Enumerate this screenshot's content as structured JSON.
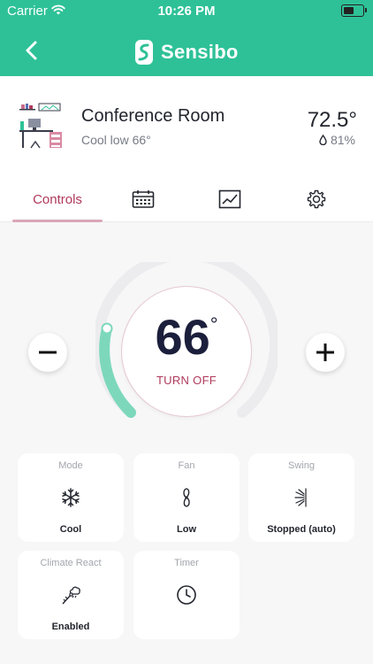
{
  "status_bar": {
    "carrier": "Carrier",
    "time": "10:26 PM"
  },
  "header": {
    "brand": "Sensibo",
    "accent_color": "#2ec197"
  },
  "room": {
    "name": "Conference Room",
    "status": "Cool low 66°",
    "temperature": "72.5°",
    "humidity": "81%"
  },
  "tabs": [
    {
      "label": "Controls",
      "icon": "",
      "active": true
    },
    {
      "label": "",
      "icon": "calendar-icon"
    },
    {
      "label": "",
      "icon": "chart-icon"
    },
    {
      "label": "",
      "icon": "gear-icon"
    }
  ],
  "thermostat": {
    "setpoint": "66",
    "unit": "°",
    "turn_off_label": "TURN OFF",
    "accent_color": "#b03a5b"
  },
  "cards": [
    {
      "label": "Mode",
      "value": "Cool",
      "icon": "snowflake-icon"
    },
    {
      "label": "Fan",
      "value": "Low",
      "icon": "fan-icon"
    },
    {
      "label": "Swing",
      "value": "Stopped (auto)",
      "icon": "swing-icon"
    },
    {
      "label": "Climate React",
      "value": "Enabled",
      "icon": "climate-react-icon"
    },
    {
      "label": "Timer",
      "value": "",
      "icon": "clock-icon"
    }
  ]
}
